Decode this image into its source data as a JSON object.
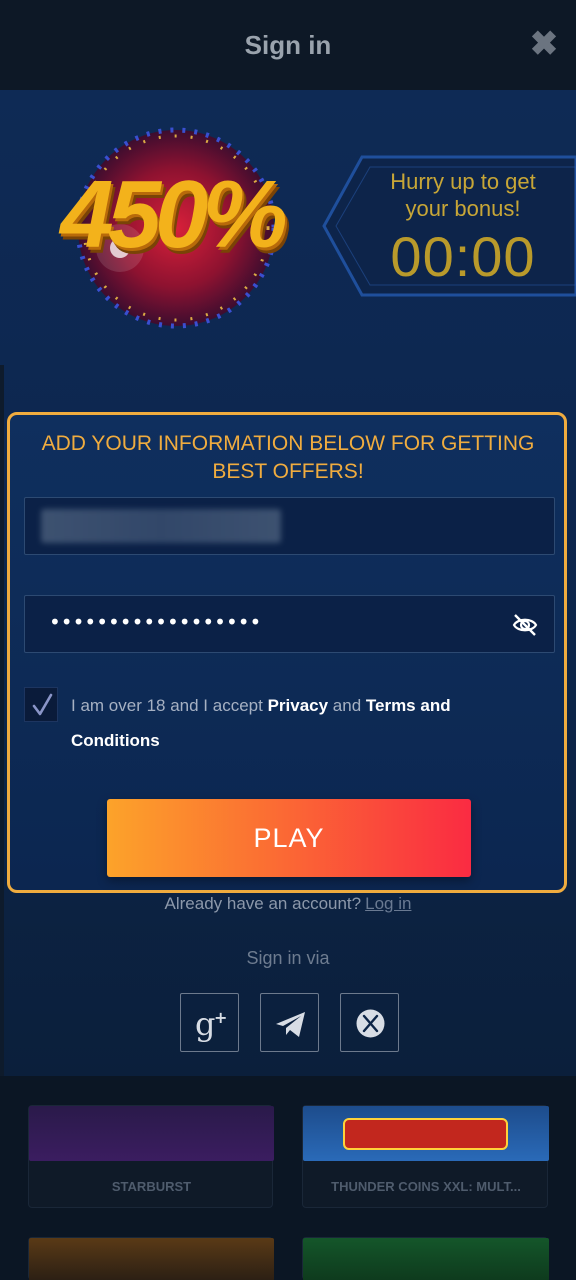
{
  "header": {
    "title": "Sign in",
    "close_label": "✖"
  },
  "banner": {
    "percent": "450%",
    "timer_caption": "Hurry up to get your bonus!",
    "timer_value": "00:00"
  },
  "form": {
    "heading": "ADD YOUR INFORMATION BELOW FOR GETTING BEST OFFERS!",
    "password_mask": "••••••••••••••••••",
    "terms_prefix": "I am over 18 and I accept ",
    "terms_privacy": "Privacy",
    "terms_and": " and ",
    "terms_link": "Terms and Conditions",
    "checkbox_checked": true,
    "play_label": "PLAY"
  },
  "account": {
    "prompt": "Already have an account?",
    "login_label": "Log in"
  },
  "signin_via": {
    "label": "Sign in via",
    "providers": [
      "google-plus-icon",
      "telegram-icon",
      "x-icon"
    ]
  },
  "games": [
    {
      "name": "STARBURST"
    },
    {
      "name": "THUNDER COINS XXL: MULT..."
    }
  ],
  "colors": {
    "accent": "#f0ac3f",
    "play_start": "#fca32a",
    "play_end": "#fa2b42",
    "timer": "#c7a637"
  }
}
